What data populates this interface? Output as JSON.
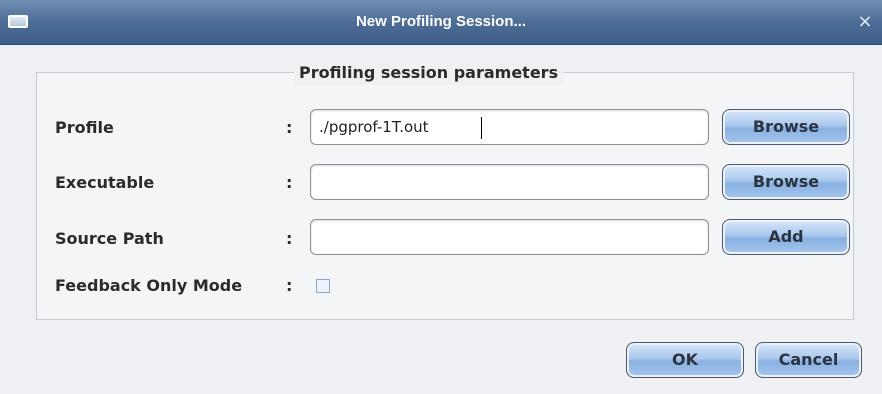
{
  "window": {
    "title": "New Profiling Session...",
    "close_glyph": "×"
  },
  "group": {
    "title": "Profiling session parameters"
  },
  "fields": {
    "profile": {
      "label": "Profile",
      "value": "./pgprof-1T.out",
      "button": "Browse"
    },
    "executable": {
      "label": "Executable",
      "value": "",
      "button": "Browse"
    },
    "source_path": {
      "label": "Source Path",
      "value": "",
      "button": "Add"
    },
    "feedback_only_mode": {
      "label": "Feedback Only Mode",
      "checked": false
    }
  },
  "separator": ":",
  "footer": {
    "ok_label": "OK",
    "cancel_label": "Cancel"
  },
  "colors": {
    "titlebar": "#4d6d96",
    "button_accent": "#89b1e2",
    "background": "#eef0f3"
  }
}
